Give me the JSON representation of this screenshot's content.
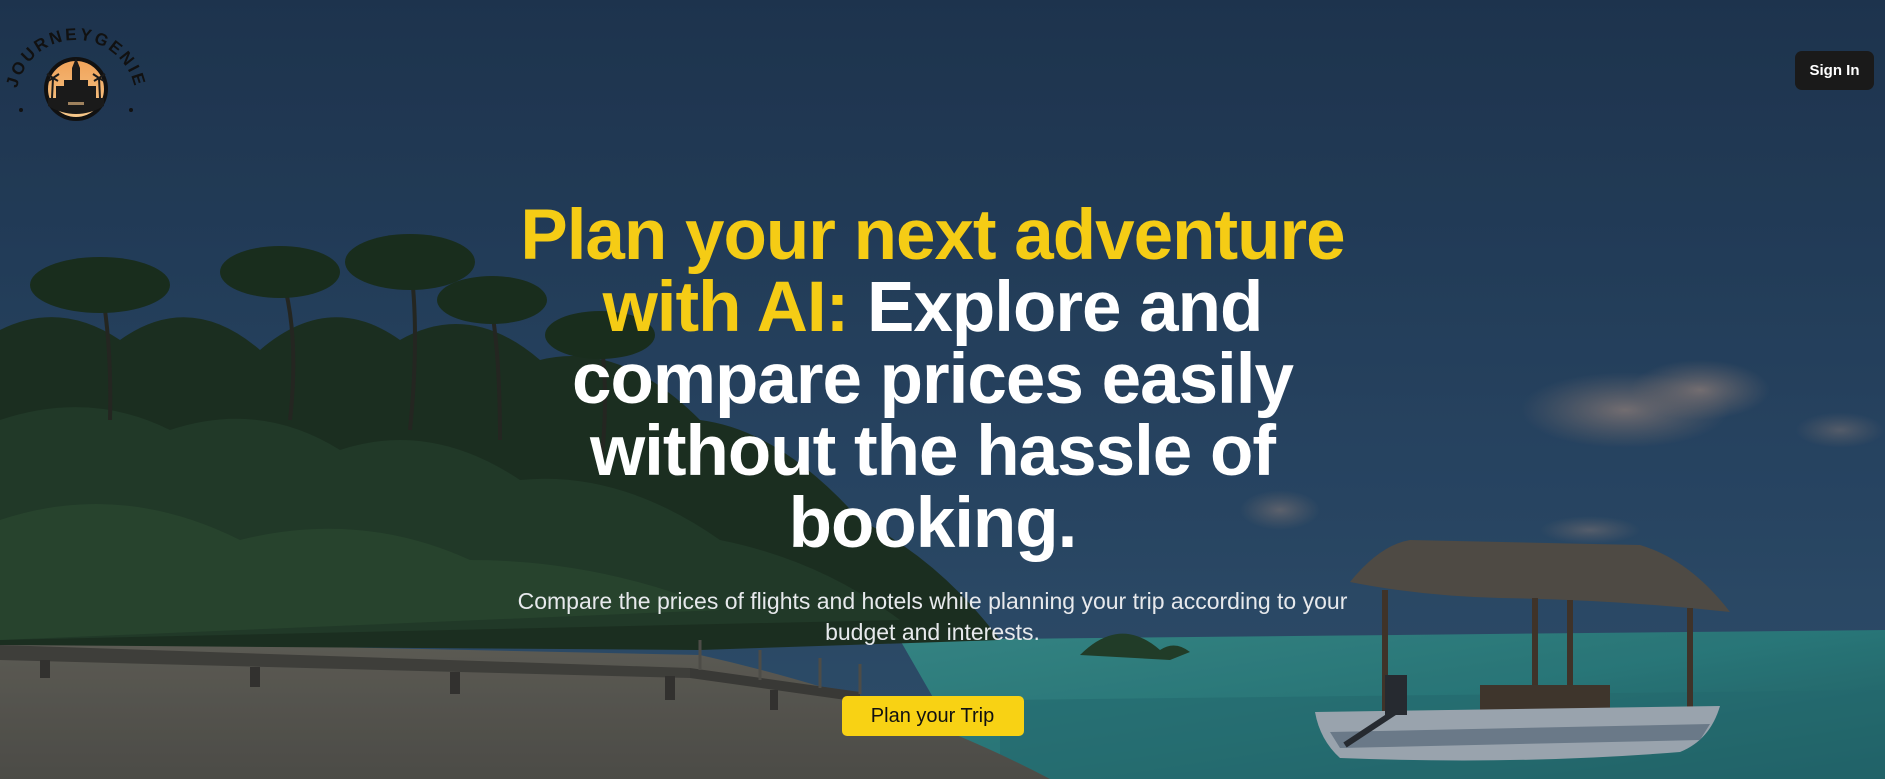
{
  "brand": {
    "logo_text": "JOURNEYGENIE",
    "icon": "palace-sunset-logo-icon"
  },
  "header": {
    "signin_label": "Sign In"
  },
  "hero": {
    "headline_highlight": "Plan your next adventure with AI:",
    "headline_rest": "Explore and compare prices easily without the hassle of booking.",
    "subtext": "Compare the prices of flights and hotels while planning your trip according to your budget and interests.",
    "cta_label": "Plan your Trip"
  },
  "colors": {
    "accent": "#f5cc15",
    "button_dark": "#1a1a1a",
    "cta": "#f8d214"
  }
}
